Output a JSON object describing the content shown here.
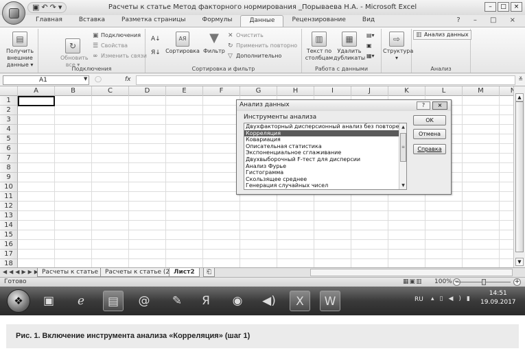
{
  "window": {
    "title": "Расчеты к статье Метод факторного нормирования _Порывaева Н.А. - Microsoft Excel",
    "quick_access": [
      "save-icon",
      "undo-icon",
      "redo-icon"
    ],
    "controls": {
      "minimize": "–",
      "restore": "□",
      "close": "×"
    }
  },
  "ribbon_tabs": [
    {
      "label": "Главная",
      "active": false
    },
    {
      "label": "Вставка",
      "active": false
    },
    {
      "label": "Разметка страницы",
      "active": false
    },
    {
      "label": "Формулы",
      "active": false
    },
    {
      "label": "Данные",
      "active": true
    },
    {
      "label": "Рецензирование",
      "active": false
    },
    {
      "label": "Вид",
      "active": false
    }
  ],
  "help_controls": "? – □ ×",
  "ribbon": {
    "get_external": {
      "label_line1": "Получить",
      "label_line2": "внешние данные ▾"
    },
    "connections": {
      "refresh_line1": "Обновить",
      "refresh_line2": "все ▾",
      "connections_label": "Подключения",
      "properties_label": "Свойства",
      "edit_links_label": "Изменить связи",
      "group_label": "Подключения"
    },
    "sort_filter": {
      "sort_label": "Сортировка",
      "filter_label": "Фильтр",
      "clear_label": "Очистить",
      "reapply_label": "Применить повторно",
      "advanced_label": "Дополнительно",
      "group_label": "Сортировка и фильтр"
    },
    "data_tools": {
      "text_to_cols_line1": "Текст по",
      "text_to_cols_line2": "столбцам",
      "remove_dup_line1": "Удалить",
      "remove_dup_line2": "дубликаты",
      "group_label": "Работа с данными"
    },
    "outline": {
      "label": "Структура"
    },
    "analysis": {
      "button_label": "Анализ данных",
      "group_label": "Анализ"
    }
  },
  "formula_bar": {
    "name_box": "A1",
    "fx": "fx",
    "value": ""
  },
  "columns": [
    "A",
    "B",
    "C",
    "D",
    "E",
    "F",
    "G",
    "H",
    "I",
    "J",
    "K",
    "L",
    "M",
    "N"
  ],
  "rows": [
    "1",
    "2",
    "3",
    "4",
    "5",
    "6",
    "7",
    "8",
    "9",
    "10",
    "11",
    "12",
    "13",
    "14",
    "15",
    "16",
    "17",
    "18"
  ],
  "sheet_tabs": [
    {
      "label": "Расчеты к статье",
      "active": false
    },
    {
      "label": "Расчеты к статье (2)",
      "active": false
    },
    {
      "label": "Лист2",
      "active": true
    }
  ],
  "status": {
    "text": "Готово",
    "zoom": "100%"
  },
  "taskbar": {
    "apps": [
      "media-icon",
      "ie-icon",
      "explorer-icon",
      "at-icon",
      "tools-icon",
      "yandex-icon",
      "opera-icon",
      "sound-icon",
      "excel-icon",
      "word-icon"
    ],
    "language": "RU",
    "time": "14:51",
    "date": "19.09.2017"
  },
  "dialog": {
    "title": "Анализ данных",
    "help_button": "?",
    "close_button": "×",
    "tools_label": "Инструменты анализа",
    "items": [
      "Двухфакторный дисперсионный анализ без повторений",
      "Корреляция",
      "Ковариация",
      "Описательная статистика",
      "Экспоненциальное сглаживание",
      "Двухвыборочный F-тест для дисперсии",
      "Анализ Фурье",
      "Гистограмма",
      "Скользящее среднее",
      "Генерация случайных чисел"
    ],
    "selected_index": 1,
    "ok_button": "OK",
    "cancel_button": "Отмена",
    "help_text_button": "Справка"
  },
  "caption": "Рис. 1. Включение инструмента анализа «Корреляция» (шаг 1)"
}
